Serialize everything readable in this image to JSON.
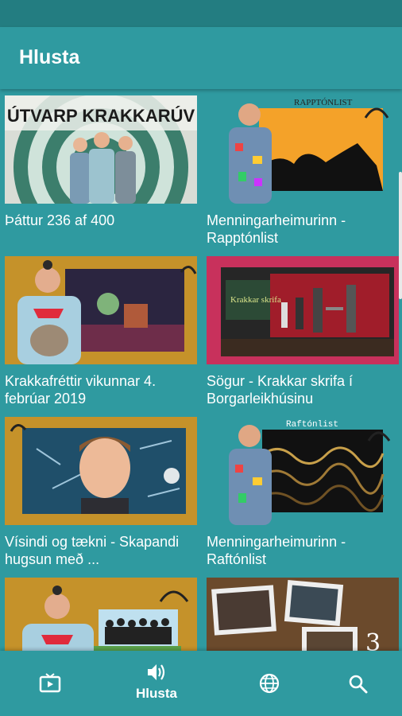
{
  "app": {
    "title": "Hlusta"
  },
  "thumbnails": {
    "krakkaruv_banner": "ÚTVARP KRAKKARÚV",
    "rapp_banner": "RAPPTÓNLIST",
    "krakkar_skrifa_banner": "Krakkar skrifa",
    "raft_banner": "Raftónlist"
  },
  "cards": [
    {
      "title": "Þáttur 236 af 400"
    },
    {
      "title": "Menningarheimurinn - Rapptónlist"
    },
    {
      "title": "Krakkafréttir vikunnar 4. febrúar 2019"
    },
    {
      "title": "Sögur - Krakkar skrifa í Borgarleikhúsinu"
    },
    {
      "title": "Vísindi og tækni - Skapandi hugsun með ..."
    },
    {
      "title": "Menningarheimurinn - Raftónlist"
    }
  ],
  "bottom_nav": {
    "items": [
      {
        "icon": "tv-icon",
        "label": ""
      },
      {
        "icon": "speaker-icon",
        "label": "Hlusta",
        "active": true
      },
      {
        "icon": "globe-icon",
        "label": ""
      },
      {
        "icon": "search-icon",
        "label": ""
      }
    ]
  },
  "colors": {
    "primary": "#2f9aa0",
    "status": "#237d81",
    "gold": "#c5922a",
    "pink": "#c8315c"
  }
}
